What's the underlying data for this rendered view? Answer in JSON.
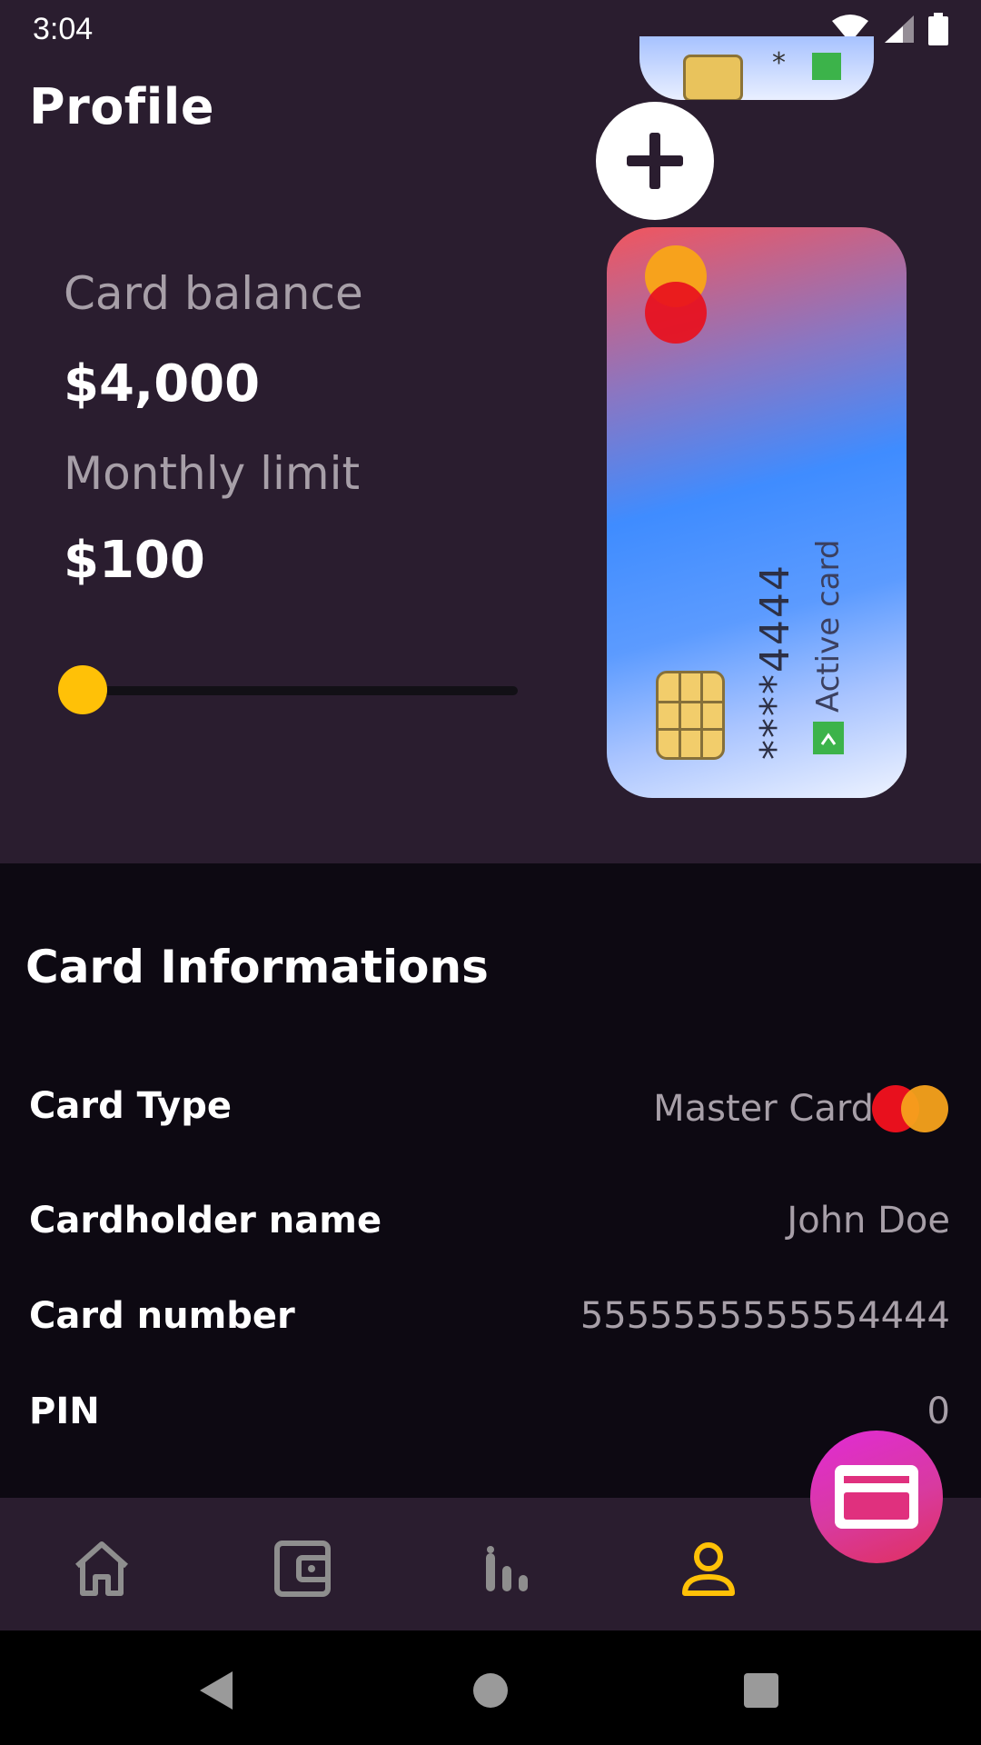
{
  "status_bar": {
    "time": "3:04",
    "icons": [
      "wifi-icon",
      "signal-icon",
      "battery-icon"
    ]
  },
  "header": {
    "title": "Profile"
  },
  "balance": {
    "balance_label": "Card balance",
    "balance_value": "$4,000",
    "limit_label": "Monthly limit",
    "limit_value": "$100",
    "slider_level": 0
  },
  "card": {
    "number_masked": "****4444",
    "status_label": "Active card",
    "status_icon": "check-icon"
  },
  "card_info": {
    "title": "Card Informations",
    "rows": [
      {
        "label": "Card Type",
        "value": "Master Card"
      },
      {
        "label": "Cardholder name",
        "value": "John Doe"
      },
      {
        "label": "Card number",
        "value": "5555555555554444"
      },
      {
        "label": "PIN",
        "value": "0"
      }
    ]
  },
  "bottom_nav": {
    "items": [
      "home-icon",
      "wallet-icon",
      "stats-icon",
      "profile-icon"
    ],
    "active": "profile-icon",
    "fab_icon": "credit-card-icon"
  },
  "colors": {
    "background": "#2a1d2f",
    "sheet": "#0d0912",
    "accent": "#ffc107",
    "muted_text": "#a79fa8"
  }
}
